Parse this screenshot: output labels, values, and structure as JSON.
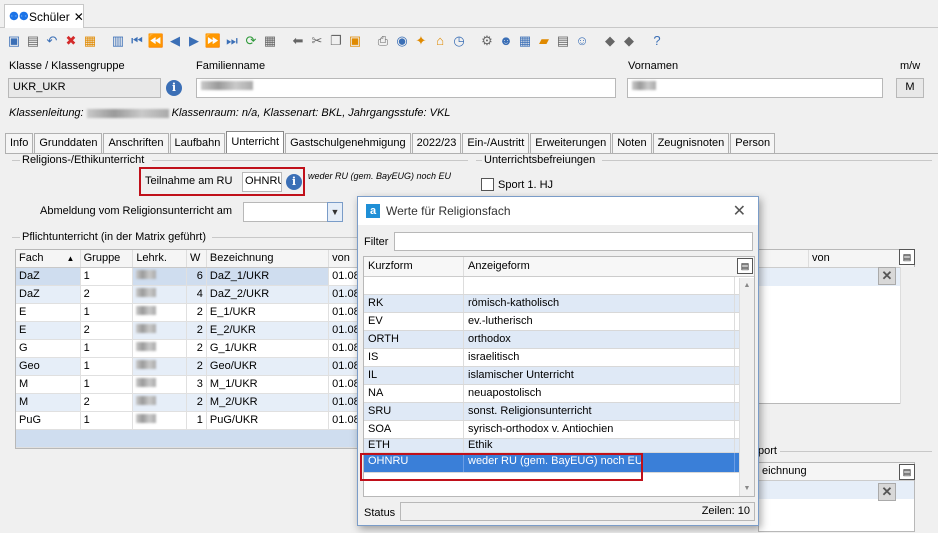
{
  "window": {
    "tab_title": "Schüler"
  },
  "header": {
    "class_label": "Klasse / Klassengruppe",
    "class_value": "UKR_UKR",
    "lastname_label": "Familienname",
    "firstname_label": "Vornamen",
    "gender_label": "m/w",
    "gender_value": "M",
    "class_info_prefix": "Klassenleitung:",
    "class_info_suffix": "Klassenraum: n/a, Klassenart: BKL, Jahrgangsstufe: VKL"
  },
  "tabs": [
    {
      "label": "Info"
    },
    {
      "label": "Grunddaten"
    },
    {
      "label": "Anschriften"
    },
    {
      "label": "Laufbahn"
    },
    {
      "label": "Unterricht"
    },
    {
      "label": "Gastschulgenehmigung"
    },
    {
      "label": "2022/23"
    },
    {
      "label": "Ein-/Austritt"
    },
    {
      "label": "Erweiterungen"
    },
    {
      "label": "Noten"
    },
    {
      "label": "Zeugnisnoten"
    },
    {
      "label": "Person"
    }
  ],
  "religion": {
    "group_title": "Religions-/Ethikunterricht",
    "participation_label": "Teilnahme am RU",
    "participation_value": "OHNRU",
    "participation_desc": "weder RU (gem. BayEUG) noch EU",
    "withdrawal_label": "Abmeldung vom Religionsunterricht am"
  },
  "exemptions": {
    "group_title": "Unterrichtsbefreiungen",
    "sport_label": "Sport 1. HJ"
  },
  "matrix": {
    "group_title": "Pflichtunterricht (in der Matrix geführt)",
    "columns": [
      "Fach",
      "Gruppe",
      "Lehrk.",
      "W",
      "Bezeichnung",
      "von"
    ],
    "rows": [
      {
        "fach": "DaZ",
        "gruppe": "1",
        "w": "6",
        "bez": "DaZ_1/UKR",
        "von": "01.08"
      },
      {
        "fach": "DaZ",
        "gruppe": "2",
        "w": "4",
        "bez": "DaZ_2/UKR",
        "von": "01.08"
      },
      {
        "fach": "E",
        "gruppe": "1",
        "w": "2",
        "bez": "E_1/UKR",
        "von": "01.08"
      },
      {
        "fach": "E",
        "gruppe": "2",
        "w": "2",
        "bez": "E_2/UKR",
        "von": "01.08"
      },
      {
        "fach": "G",
        "gruppe": "1",
        "w": "2",
        "bez": "G_1/UKR",
        "von": "01.08"
      },
      {
        "fach": "Geo",
        "gruppe": "1",
        "w": "2",
        "bez": "Geo/UKR",
        "von": "01.08"
      },
      {
        "fach": "M",
        "gruppe": "1",
        "w": "3",
        "bez": "M_1/UKR",
        "von": "01.08"
      },
      {
        "fach": "M",
        "gruppe": "2",
        "w": "2",
        "bez": "M_2/UKR",
        "von": "01.08"
      },
      {
        "fach": "PuG",
        "gruppe": "1",
        "w": "1",
        "bez": "PuG/UKR",
        "von": "01.08"
      }
    ]
  },
  "right_grid": {
    "col_von": "von",
    "lower_label_1": "port",
    "lower_label_2": "eichnung"
  },
  "dialog": {
    "title": "Werte für Religionsfach",
    "filter_label": "Filter",
    "col_short": "Kurzform",
    "col_display": "Anzeigeform",
    "rows": [
      {
        "k": "",
        "a": ""
      },
      {
        "k": "RK",
        "a": "römisch-katholisch"
      },
      {
        "k": "EV",
        "a": "ev.-lutherisch"
      },
      {
        "k": "ORTH",
        "a": "orthodox"
      },
      {
        "k": "IS",
        "a": "israelitisch"
      },
      {
        "k": "IL",
        "a": "islamischer Unterricht"
      },
      {
        "k": "NA",
        "a": "neuapostolisch"
      },
      {
        "k": "SRU",
        "a": "sonst. Religionsunterricht"
      },
      {
        "k": "SOA",
        "a": "syrisch-orthodox v. Antiochien"
      },
      {
        "k": "ETH",
        "a": "Ethik"
      },
      {
        "k": "OHNRU",
        "a": "weder RU (gem. BayEUG) noch EU"
      }
    ],
    "status_label": "Status",
    "rows_count": "Zeilen: 10"
  }
}
